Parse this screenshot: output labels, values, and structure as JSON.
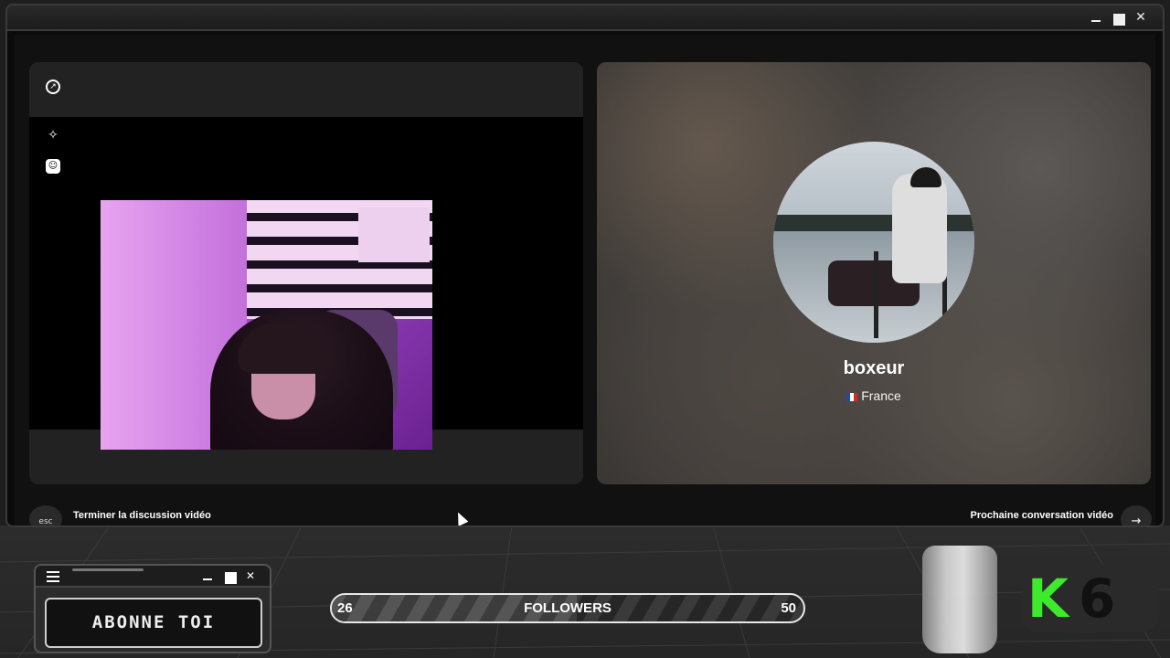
{
  "profile": {
    "username": "boxeur",
    "country": "France"
  },
  "footer": {
    "esc_key": "esc",
    "end_label": "Terminer la discussion vidéo",
    "next_label": "Prochaine conversation vidéo",
    "next_arrow": "→"
  },
  "window": {
    "minimize": "",
    "maximize": "",
    "close": "✕"
  },
  "toolbar": {
    "expand_icon": "↗",
    "wand_icon": "✧",
    "smile_icon": "☺"
  },
  "overlay": {
    "subscribe_label": "ABONNE TOI",
    "mini_close": "✕",
    "followers_label": "FOLLOWERS",
    "followers_current": "26",
    "followers_goal": "50",
    "followers_progress": 0.52,
    "logo_letter": "K",
    "logo_digit": "6"
  },
  "colors": {
    "accent_green": "#3dea2c",
    "flag_blue": "#1f4aa8",
    "flag_red": "#d12a2a"
  }
}
